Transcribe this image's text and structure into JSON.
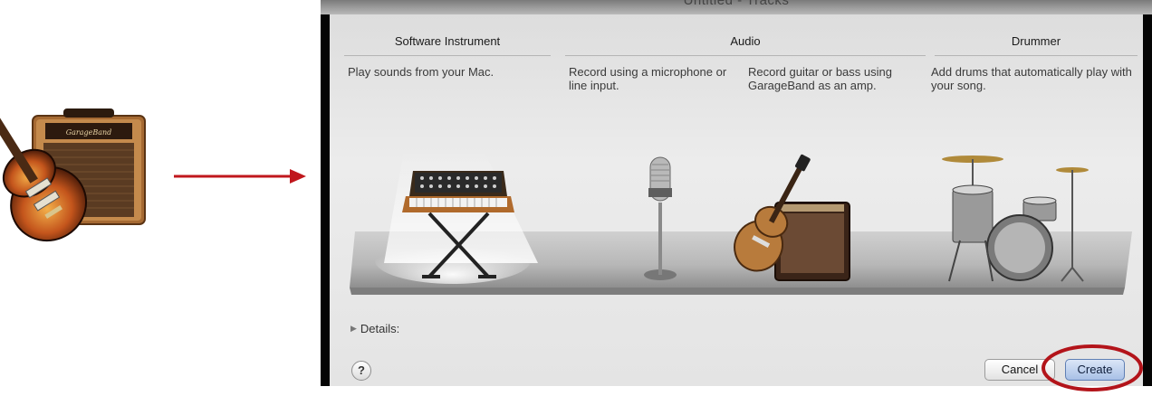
{
  "window": {
    "title": "Untitled - Tracks"
  },
  "categories": [
    {
      "name": "Software Instrument"
    },
    {
      "name": "Audio"
    },
    {
      "name": "Drummer"
    }
  ],
  "options": [
    {
      "description": "Play sounds from your Mac.",
      "icon": "keyboard-synth-icon",
      "selected": true
    },
    {
      "description": "Record using a microphone or line input.",
      "icon": "microphone-icon",
      "selected": false
    },
    {
      "description": "Record guitar or bass using GarageBand as an amp.",
      "icon": "guitar-amp-icon",
      "selected": false
    },
    {
      "description": "Add drums that automatically play with your song.",
      "icon": "drum-kit-icon",
      "selected": false
    }
  ],
  "details": {
    "label": "Details:",
    "expanded": false
  },
  "buttons": {
    "help": "?",
    "cancel": "Cancel",
    "create": "Create"
  },
  "annotations": {
    "arrow_color": "#c0171c",
    "highlight_color": "#b3141a"
  },
  "app_icon": {
    "name": "garageband-app-icon",
    "amp_logo": "GarageBand"
  },
  "colors": {
    "dialog_bg": "#e6e6e6",
    "create_button": "#a8c0e6"
  }
}
